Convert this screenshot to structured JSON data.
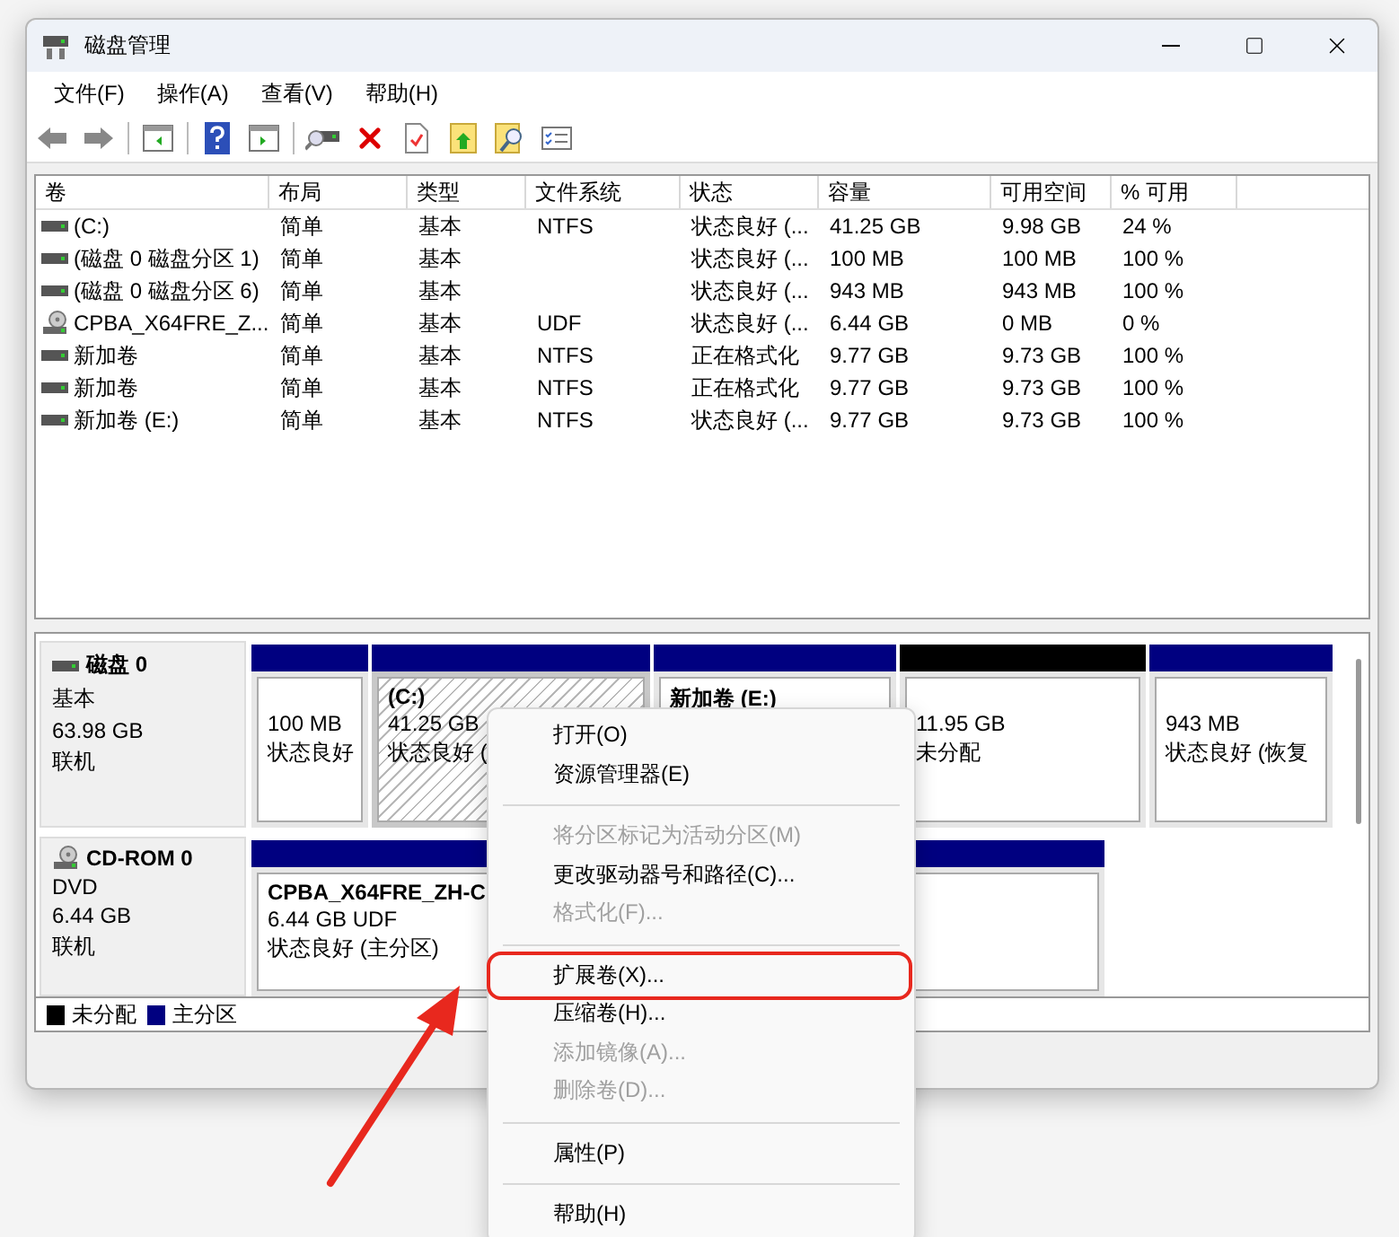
{
  "window": {
    "title": "磁盘管理"
  },
  "menu": [
    "文件(F)",
    "操作(A)",
    "查看(V)",
    "帮助(H)"
  ],
  "table": {
    "columns": [
      "卷",
      "布局",
      "类型",
      "文件系统",
      "状态",
      "容量",
      "可用空间",
      "% 可用"
    ],
    "rows": [
      {
        "kind": "disk",
        "cells": [
          "(C:)",
          "简单",
          "基本",
          "NTFS",
          "状态良好 (...",
          "41.25 GB",
          "9.98 GB",
          "24 %"
        ]
      },
      {
        "kind": "disk",
        "cells": [
          "(磁盘 0 磁盘分区 1)",
          "简单",
          "基本",
          "",
          "状态良好 (...",
          "100 MB",
          "100 MB",
          "100 %"
        ]
      },
      {
        "kind": "disk",
        "cells": [
          "(磁盘 0 磁盘分区 6)",
          "简单",
          "基本",
          "",
          "状态良好 (...",
          "943 MB",
          "943 MB",
          "100 %"
        ]
      },
      {
        "kind": "cd",
        "cells": [
          "CPBA_X64FRE_Z...",
          "简单",
          "基本",
          "UDF",
          "状态良好 (...",
          "6.44 GB",
          "0 MB",
          "0 %"
        ]
      },
      {
        "kind": "disk",
        "cells": [
          "新加卷",
          "简单",
          "基本",
          "NTFS",
          "正在格式化",
          "9.77 GB",
          "9.73 GB",
          "100 %"
        ]
      },
      {
        "kind": "disk",
        "cells": [
          "新加卷",
          "简单",
          "基本",
          "NTFS",
          "正在格式化",
          "9.77 GB",
          "9.73 GB",
          "100 %"
        ]
      },
      {
        "kind": "disk",
        "cells": [
          "新加卷 (E:)",
          "简单",
          "基本",
          "NTFS",
          "状态良好 (...",
          "9.77 GB",
          "9.73 GB",
          "100 %"
        ]
      }
    ]
  },
  "disks": [
    {
      "kind": "disk",
      "name": "磁盘 0",
      "type": "基本",
      "size": "63.98 GB",
      "status": "联机",
      "partitions": [
        {
          "color": "#000080",
          "size": "100 MB",
          "status": "状态良好",
          "selected": false
        },
        {
          "color": "#000080",
          "label": "(C:)",
          "size": "41.25 GB",
          "status": "状态良好 (",
          "selected": true
        },
        {
          "color": "#000080",
          "label": "新加卷 (E:)",
          "selected": false
        },
        {
          "color": "#000000",
          "size": "11.95 GB",
          "status": "未分配",
          "selected": false
        },
        {
          "color": "#000080",
          "size": "943 MB",
          "status": "状态良好 (恢复",
          "selected": false
        }
      ]
    },
    {
      "kind": "cd",
      "name": "CD-ROM 0",
      "type": "DVD",
      "size": "6.44 GB",
      "status": "联机",
      "partitions": [
        {
          "color": "#000080",
          "label": "CPBA_X64FRE_ZH-C",
          "size": "6.44 GB UDF",
          "status": "状态良好 (主分区)",
          "selected": false
        }
      ]
    }
  ],
  "legend": [
    {
      "label": "未分配",
      "color": "#000000"
    },
    {
      "label": "主分区",
      "color": "#000080"
    }
  ],
  "context_menu": {
    "items": [
      {
        "kind": "item",
        "label": "打开(O)",
        "disabled": false,
        "annotated": false
      },
      {
        "kind": "item",
        "label": "资源管理器(E)",
        "disabled": false,
        "annotated": false
      },
      {
        "kind": "separator"
      },
      {
        "kind": "item",
        "label": "将分区标记为活动分区(M)",
        "disabled": true,
        "annotated": false
      },
      {
        "kind": "item",
        "label": "更改驱动器号和路径(C)...",
        "disabled": false,
        "annotated": false
      },
      {
        "kind": "item",
        "label": "格式化(F)...",
        "disabled": true,
        "annotated": false
      },
      {
        "kind": "separator"
      },
      {
        "kind": "item",
        "label": "扩展卷(X)...",
        "disabled": false,
        "annotated": true
      },
      {
        "kind": "item",
        "label": "压缩卷(H)...",
        "disabled": false,
        "annotated": false
      },
      {
        "kind": "item",
        "label": "添加镜像(A)...",
        "disabled": true,
        "annotated": false
      },
      {
        "kind": "item",
        "label": "删除卷(D)...",
        "disabled": true,
        "annotated": false
      },
      {
        "kind": "separator"
      },
      {
        "kind": "item",
        "label": "属性(P)",
        "disabled": false,
        "annotated": false
      },
      {
        "kind": "separator"
      },
      {
        "kind": "item",
        "label": "帮助(H)",
        "disabled": false,
        "annotated": false
      }
    ]
  }
}
